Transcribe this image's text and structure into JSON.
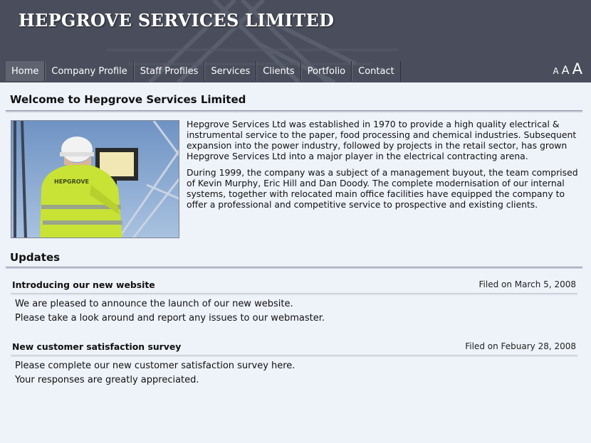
{
  "site": {
    "title": "HEPGROVE SERVICES LIMITED"
  },
  "nav": {
    "items": [
      {
        "label": "Home",
        "active": true
      },
      {
        "label": "Company Profile"
      },
      {
        "label": "Staff Profiles"
      },
      {
        "label": "Services"
      },
      {
        "label": "Clients"
      },
      {
        "label": "Portfolio"
      },
      {
        "label": "Contact"
      }
    ]
  },
  "text_size": {
    "small": "A",
    "medium": "A",
    "large": "A"
  },
  "welcome": {
    "heading": "Welcome to Hepgrove Services Limited",
    "paragraphs": [
      "Hepgrove Services Ltd was established in 1970 to provide a high quality electrical & instrumental service to the paper, food processing and chemical industries. Subsequent expansion into the power industry, followed by projects in the retail sector, has grown Hepgrove Services Ltd into a major player in the electrical contracting arena.",
      "During 1999, the company was a subject of a management buyout, the team comprised of Kevin Murphy, Eric Hill and Dan Doody. The complete modernisation of our internal systems, together with relocated main office facilities have equipped the company to offer a professional and competitive service to prospective and existing clients."
    ],
    "photo_jacket_text": "HEPGROVE"
  },
  "updates": {
    "heading": "Updates",
    "items": [
      {
        "title": "Introducing our new website",
        "date": "Filed on March 5, 2008",
        "lines": [
          "We are pleased to announce the launch of our new website.",
          "Please take a look around and report any issues to our webmaster."
        ]
      },
      {
        "title": "New customer satisfaction survey",
        "date": "Filed on Febuary 28, 2008",
        "lines": [
          "Please complete our new customer satisfaction survey here.",
          "Your responses are greatly appreciated."
        ]
      }
    ]
  },
  "colors": {
    "header_bg": "#4a4e5c",
    "page_bg": "#eef2f9",
    "nav_active": "#5f6370",
    "jacket": "#c8e236"
  }
}
